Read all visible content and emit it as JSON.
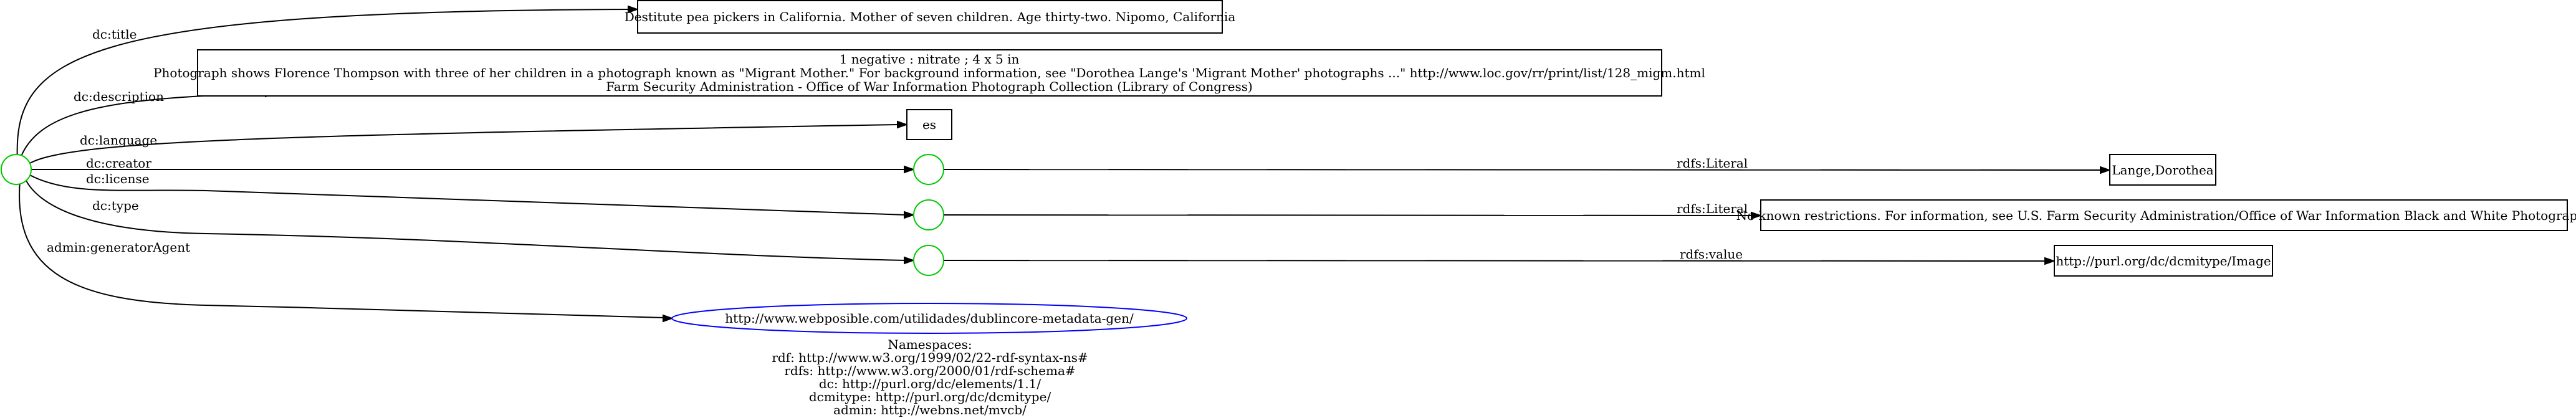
{
  "edges": {
    "title": "dc:title",
    "description": "dc:description",
    "language": "dc:language",
    "creator": "dc:creator",
    "license": "dc:license",
    "type": "dc:type",
    "generator": "admin:generatorAgent",
    "creator_value": "rdfs:Literal",
    "license_value": "rdfs:Literal",
    "type_value": "rdfs:value"
  },
  "nodes": {
    "title": "Destitute pea pickers in California. Mother of seven children. Age thirty-two. Nipomo, California",
    "description": [
      "1 negative : nitrate ; 4 x 5 in",
      "Photograph shows Florence Thompson with three of her children in a photograph known as \"Migrant Mother.\" For background information, see \"Dorothea Lange's 'Migrant Mother' photographs ...\" http://www.loc.gov/rr/print/list/128_migm.html",
      "Farm Security Administration - Office of War Information Photograph Collection (Library of Congress)"
    ],
    "language": "es",
    "creator": "Lange,Dorothea",
    "license": "No known restrictions. For information, see U.S. Farm Security Administration/Office of War Information Black and White Photographs",
    "type": "http://purl.org/dc/dcmitype/Image",
    "generator": "http://www.webposible.com/utilidades/dublincore-metadata-gen/"
  },
  "namespaces": {
    "heading": "Namespaces:",
    "lines": [
      "rdf: http://www.w3.org/1999/02/22-rdf-syntax-ns#",
      "rdfs: http://www.w3.org/2000/01/rdf-schema#",
      "dc: http://purl.org/dc/elements/1.1/",
      "dcmitype: http://purl.org/dc/dcmitype/",
      "admin: http://webns.net/mvcb/"
    ]
  },
  "colors": {
    "blank_node": "#00c800",
    "uri_node": "#0000ff",
    "literal_node": "#000000"
  }
}
